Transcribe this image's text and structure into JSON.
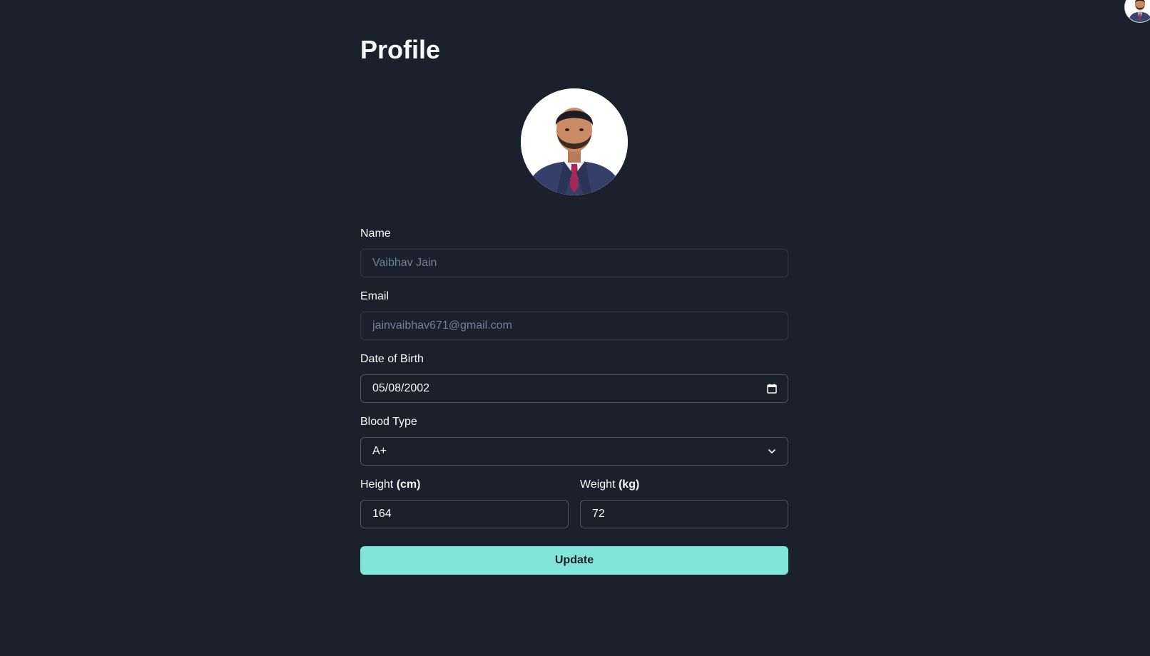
{
  "header": {
    "avatar_icon": "user-avatar-icon"
  },
  "profile": {
    "title": "Profile",
    "photo_icon": "profile-photo-icon"
  },
  "form": {
    "name": {
      "label": "Name",
      "value": "Vaibhav Jain",
      "disabled": true
    },
    "email": {
      "label": "Email",
      "value": "jainvaibhav671@gmail.com",
      "disabled": true
    },
    "dob": {
      "label": "Date of Birth",
      "value": "05/08/2002",
      "icon": "calendar-icon"
    },
    "blood_type": {
      "label": "Blood Type",
      "value": "A+",
      "icon": "chevron-down-icon"
    },
    "height": {
      "label": "Height",
      "unit": "(cm)",
      "value": "164"
    },
    "weight": {
      "label": "Weight",
      "unit": "(kg)",
      "value": "72"
    },
    "submit_label": "Update"
  },
  "colors": {
    "background": "#1a202c",
    "accent": "#81e6d9",
    "border": "#2d3748"
  }
}
